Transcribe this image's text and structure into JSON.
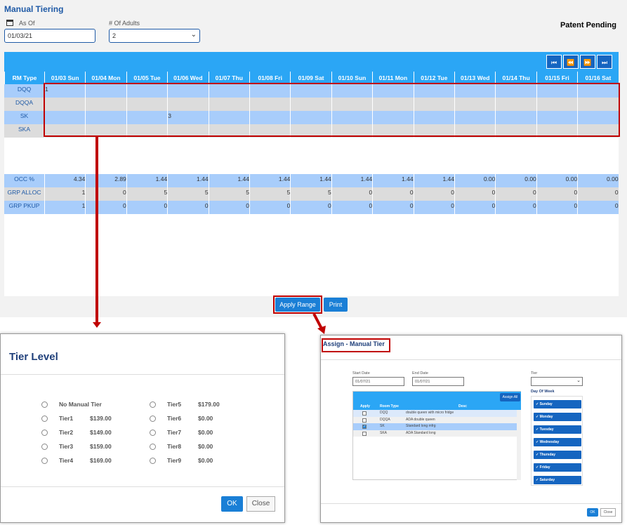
{
  "main": {
    "title": "Manual Tiering",
    "as_of_label": "As Of",
    "as_of_value": "01/03/21",
    "adults_label": "# Of Adults",
    "adults_value": "2",
    "patent": "Patent Pending"
  },
  "grid": {
    "nav": [
      "⏮",
      "⏪",
      "⏩",
      "⏭"
    ],
    "headers": [
      "RM Type",
      "01/03 Sun",
      "01/04 Mon",
      "01/05 Tue",
      "01/06 Wed",
      "01/07 Thu",
      "01/08 Fri",
      "01/09 Sat",
      "01/10 Sun",
      "01/11 Mon",
      "01/12 Tue",
      "01/13 Wed",
      "01/14 Thu",
      "01/15 Fri",
      "01/16 Sat"
    ],
    "room_rows": [
      {
        "label": "DQQ",
        "cells": [
          "1",
          "",
          "",
          "",
          "",
          "",
          "",
          "",
          "",
          "",
          "",
          "",
          "",
          ""
        ]
      },
      {
        "label": "DQQA",
        "cells": [
          "",
          "",
          "",
          "",
          "",
          "",
          "",
          "",
          "",
          "",
          "",
          "",
          "",
          ""
        ]
      },
      {
        "label": "SK",
        "cells": [
          "",
          "",
          "",
          "3",
          "",
          "",
          "",
          "",
          "",
          "",
          "",
          "",
          "",
          ""
        ]
      },
      {
        "label": "SKA",
        "cells": [
          "",
          "",
          "",
          "",
          "",
          "",
          "",
          "",
          "",
          "",
          "",
          "",
          "",
          ""
        ]
      }
    ],
    "stat_rows": [
      {
        "label": "OCC %",
        "cells": [
          "4.34",
          "2.89",
          "1.44",
          "1.44",
          "1.44",
          "1.44",
          "1.44",
          "1.44",
          "1.44",
          "1.44",
          "0.00",
          "0.00",
          "0.00",
          "0.00"
        ]
      },
      {
        "label": "GRP ALLOC",
        "cells": [
          "1",
          "0",
          "5",
          "5",
          "5",
          "5",
          "5",
          "0",
          "0",
          "0",
          "0",
          "0",
          "0",
          "0"
        ]
      },
      {
        "label": "GRP PKUP",
        "cells": [
          "1",
          "0",
          "0",
          "0",
          "0",
          "0",
          "0",
          "0",
          "0",
          "0",
          "0",
          "0",
          "0",
          "0"
        ]
      }
    ]
  },
  "buttons": {
    "apply_range": "Apply Range",
    "print": "Print"
  },
  "tier_dialog": {
    "title": "Tier Level",
    "options_left": [
      {
        "name": "No Manual Tier",
        "price": ""
      },
      {
        "name": "Tier1",
        "price": "$139.00"
      },
      {
        "name": "Tier2",
        "price": "$149.00"
      },
      {
        "name": "Tier3",
        "price": "$159.00"
      },
      {
        "name": "Tier4",
        "price": "$169.00"
      }
    ],
    "options_right": [
      {
        "name": "Tier5",
        "price": "$179.00"
      },
      {
        "name": "Tier6",
        "price": "$0.00"
      },
      {
        "name": "Tier7",
        "price": "$0.00"
      },
      {
        "name": "Tier8",
        "price": "$0.00"
      },
      {
        "name": "Tier9",
        "price": "$0.00"
      }
    ],
    "ok": "OK",
    "close": "Close"
  },
  "assign_dialog": {
    "title": "Assign - Manual Tier",
    "start_label": "Start Date",
    "start_value": "01/07/21",
    "end_label": "End Date",
    "end_value": "01/07/21",
    "tier_label": "Tier",
    "dow_label": "Day Of Week",
    "assign_all": "Assign All",
    "col_apply": "Apply",
    "col_room": "Room Type",
    "col_desc": "Desc",
    "rows": [
      {
        "room": "DQQ",
        "desc": "double queen with micro fridge",
        "checked": false
      },
      {
        "room": "DQQA",
        "desc": "ADA double queen",
        "checked": false
      },
      {
        "room": "SK",
        "desc": "Standard long mfrg",
        "checked": true
      },
      {
        "room": "SKA",
        "desc": "ADA Standard long",
        "checked": false
      }
    ],
    "days": [
      "✓ Sunday",
      "✓ Monday",
      "✓ Tuesday",
      "✓ Wednesday",
      "✓ Thursday",
      "✓ Friday",
      "✓ Saturday"
    ],
    "ok": "OK",
    "close": "Close"
  }
}
